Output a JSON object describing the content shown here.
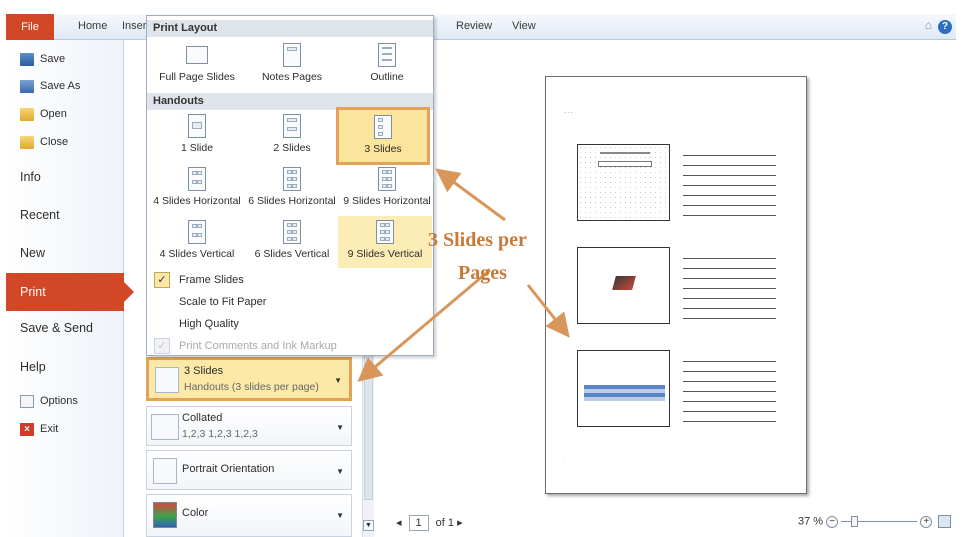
{
  "ribbon": {
    "file_tab": "File",
    "tabs": [
      "Home",
      "Insert",
      "Review",
      "View"
    ]
  },
  "nav": {
    "save": "Save",
    "save_as": "Save As",
    "open": "Open",
    "close": "Close",
    "info": "Info",
    "recent": "Recent",
    "new": "New",
    "print": "Print",
    "save_send": "Save & Send",
    "help": "Help",
    "options": "Options",
    "exit": "Exit"
  },
  "dropdown": {
    "print_layout_header": "Print Layout",
    "print_layouts": [
      "Full Page Slides",
      "Notes Pages",
      "Outline"
    ],
    "handouts_header": "Handouts",
    "handouts_row1": [
      "1 Slide",
      "2 Slides",
      "3 Slides"
    ],
    "handouts_row2": [
      "4 Slides Horizontal",
      "6 Slides Horizontal",
      "9 Slides Horizontal"
    ],
    "handouts_row3": [
      "4 Slides Vertical",
      "6 Slides Vertical",
      "9 Slides Vertical"
    ],
    "options": {
      "frame_slides": "Frame Slides",
      "scale_to_fit": "Scale to Fit Paper",
      "high_quality": "High Quality",
      "print_comments": "Print Comments and Ink Markup"
    }
  },
  "settings": {
    "layout_title": "3 Slides",
    "layout_sub": "Handouts (3 slides per page)",
    "collated_title": "Collated",
    "collated_sub": "1,2,3   1,2,3   1,2,3",
    "orientation": "Portrait Orientation",
    "color": "Color"
  },
  "annotation": {
    "line1": "3 Slides per",
    "line2": "Pages"
  },
  "page_nav": {
    "current_page": "1",
    "of_label": "of 1"
  },
  "zoom": {
    "level": "37 %"
  },
  "colors": {
    "accent": "#d24726",
    "highlight": "#fbe49b",
    "annotation": "#c77b3a"
  }
}
